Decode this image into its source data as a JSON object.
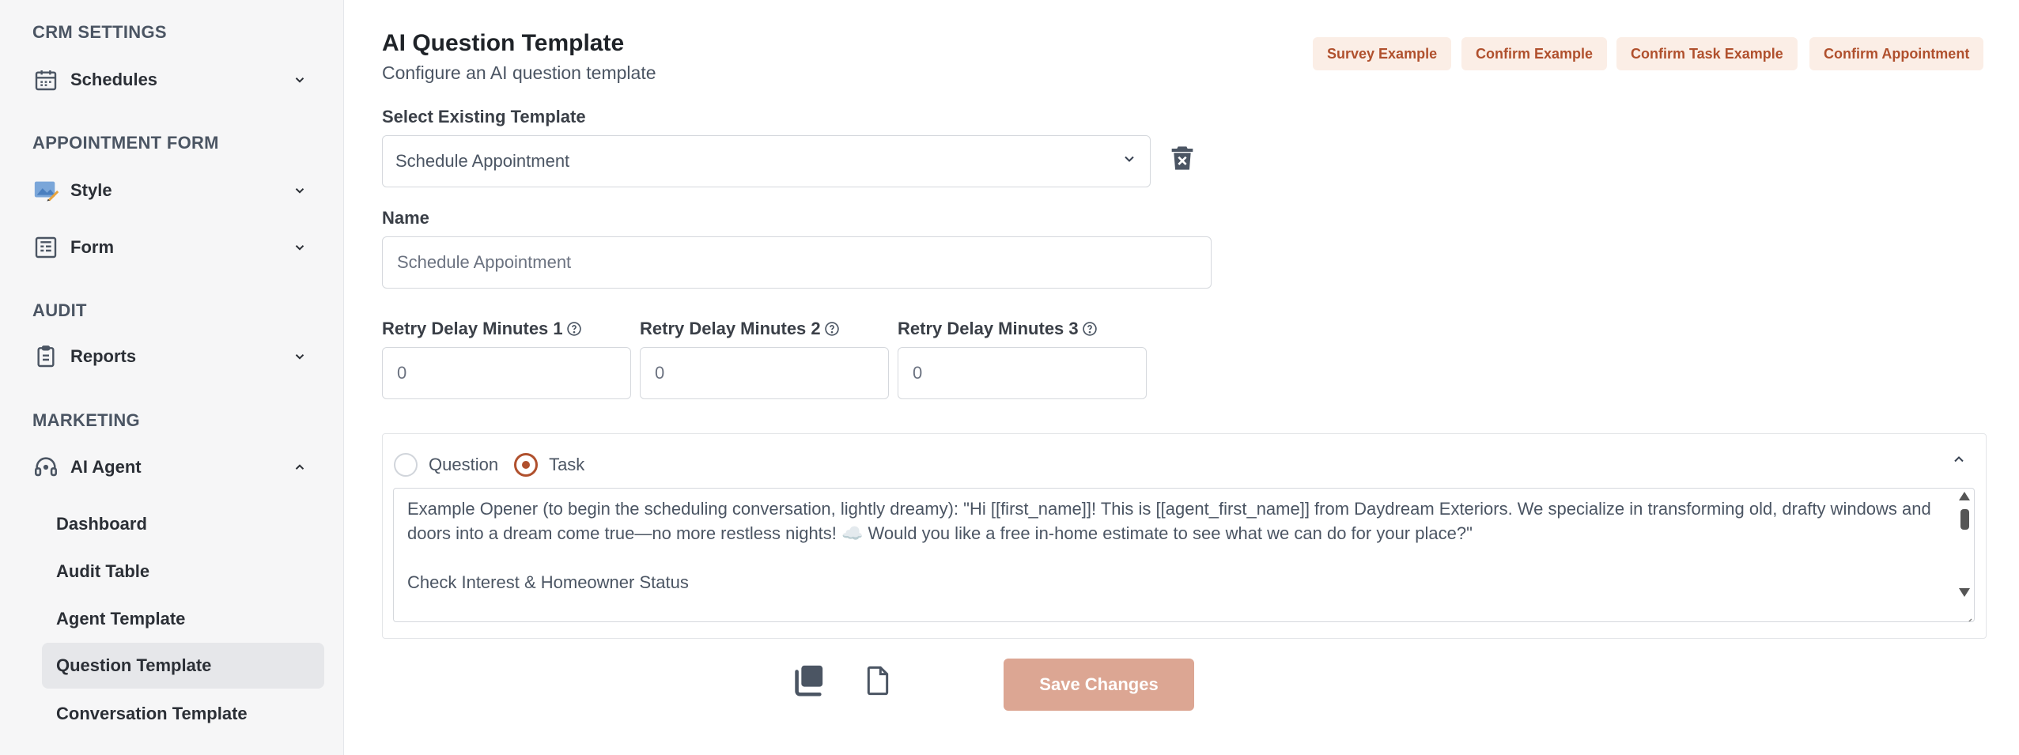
{
  "sidebar": {
    "sections": [
      {
        "heading": "CRM SETTINGS"
      },
      {
        "heading": "APPOINTMENT FORM"
      },
      {
        "heading": "AUDIT"
      },
      {
        "heading": "MARKETING"
      }
    ],
    "items": {
      "schedules": "Schedules",
      "style": "Style",
      "form": "Form",
      "reports": "Reports",
      "ai_agent": "AI Agent"
    },
    "ai_agent_sub": [
      "Dashboard",
      "Audit Table",
      "Agent Template",
      "Question Template",
      "Conversation Template"
    ],
    "active_sub": "Question Template"
  },
  "header": {
    "title": "AI Question Template",
    "subtitle": "Configure an AI question template",
    "examples": [
      "Survey Example",
      "Confirm Example",
      "Confirm Task Example",
      "Confirm Appointment"
    ]
  },
  "form": {
    "select_label": "Select Existing Template",
    "select_value": "Schedule Appointment",
    "name_label": "Name",
    "name_value": "Schedule Appointment",
    "retry1_label": "Retry Delay Minutes 1",
    "retry1_value": "0",
    "retry2_label": "Retry Delay Minutes 2",
    "retry2_value": "0",
    "retry3_label": "Retry Delay Minutes 3",
    "retry3_value": "0",
    "type_options": [
      "Question",
      "Task"
    ],
    "type_selected": "Task",
    "content_line1": "Example Opener (to begin the scheduling conversation, lightly dreamy): \"Hi [[first_name]]! This is [[agent_first_name]] from Daydream Exteriors. We specialize in transforming old, drafty windows and doors into a dream come true—no more restless nights! ☁️ Would you like a free in-home estimate to see what we can do for your place?\"",
    "content_line2": "Check Interest & Homeowner Status",
    "save_label": "Save Changes"
  },
  "colors": {
    "accent": "#b0502d",
    "accent_soft": "#fbeee6",
    "save_disabled": "#dca693",
    "sidebar_bg": "#f6f6f7"
  }
}
